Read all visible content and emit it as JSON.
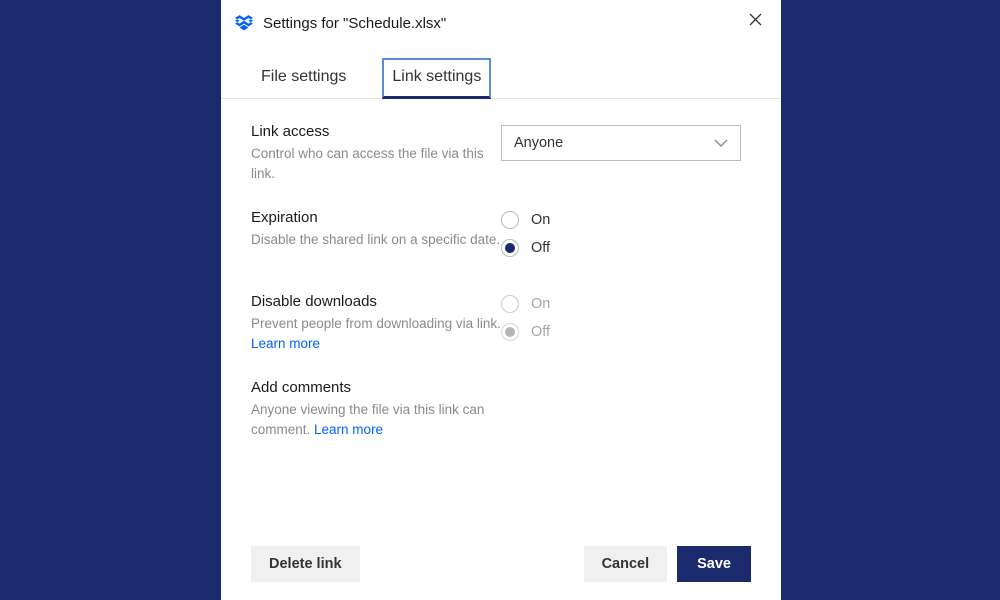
{
  "header": {
    "title": "Settings for \"Schedule.xlsx\""
  },
  "tabs": {
    "file_settings": "File settings",
    "link_settings": "Link settings"
  },
  "link_access": {
    "title": "Link access",
    "desc": "Control who can access the file via this link.",
    "selected": "Anyone"
  },
  "expiration": {
    "title": "Expiration",
    "desc": "Disable the shared link on a specific date.",
    "on": "On",
    "off": "Off"
  },
  "disable_downloads": {
    "title": "Disable downloads",
    "desc": "Prevent people from downloading via link.  ",
    "learn_more": "Learn more",
    "on": "On",
    "off": "Off"
  },
  "add_comments": {
    "title": "Add comments",
    "desc": "Anyone viewing the file via this link can comment.  ",
    "learn_more": "Learn more"
  },
  "footer": {
    "delete": "Delete link",
    "cancel": "Cancel",
    "save": "Save"
  }
}
